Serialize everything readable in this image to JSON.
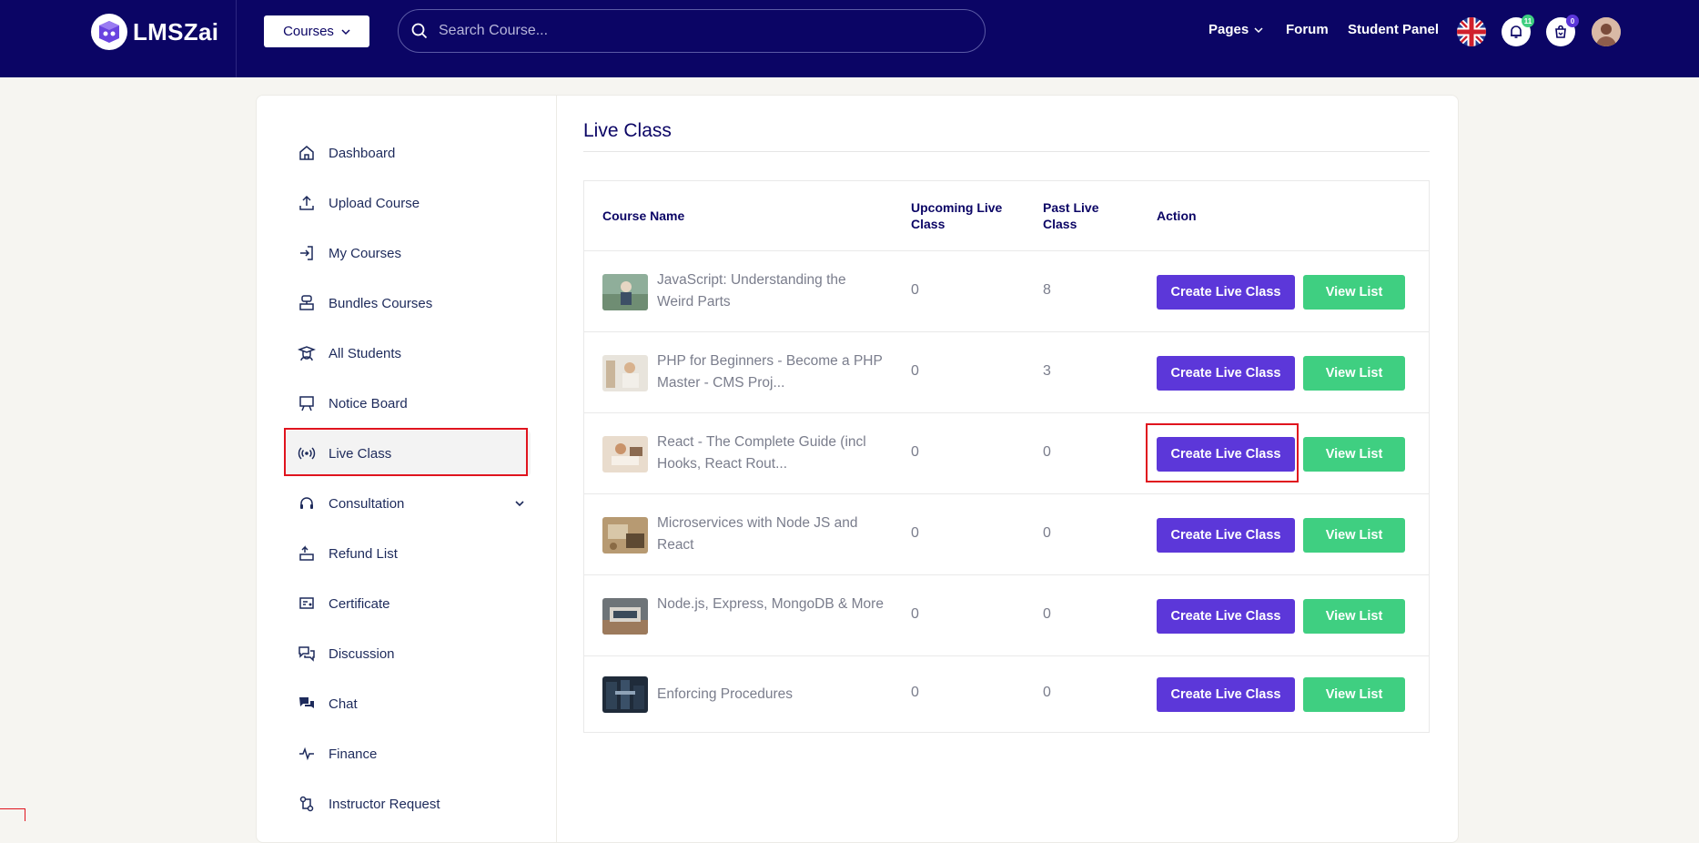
{
  "brand": {
    "name": "LMSZai"
  },
  "header": {
    "courses_label": "Courses",
    "search_placeholder": "Search Course...",
    "nav": {
      "pages": "Pages",
      "forum": "Forum",
      "student_panel": "Student Panel"
    },
    "notification_count": "11",
    "cart_count": "0"
  },
  "sidebar": {
    "items": [
      {
        "label": "Dashboard",
        "icon": "home-icon"
      },
      {
        "label": "Upload Course",
        "icon": "upload-icon"
      },
      {
        "label": "My Courses",
        "icon": "login-icon"
      },
      {
        "label": "Bundles Courses",
        "icon": "bundle-icon"
      },
      {
        "label": "All Students",
        "icon": "student-icon"
      },
      {
        "label": "Notice Board",
        "icon": "board-icon"
      },
      {
        "label": "Live Class",
        "icon": "broadcast-icon",
        "active": true
      },
      {
        "label": "Consultation",
        "icon": "headset-icon",
        "expandable": true
      },
      {
        "label": "Refund List",
        "icon": "refund-icon"
      },
      {
        "label": "Certificate",
        "icon": "certificate-icon"
      },
      {
        "label": "Discussion",
        "icon": "discussion-icon"
      },
      {
        "label": "Chat",
        "icon": "chat-icon"
      },
      {
        "label": "Finance",
        "icon": "pulse-icon"
      },
      {
        "label": "Instructor Request",
        "icon": "request-icon"
      }
    ]
  },
  "main": {
    "title": "Live Class",
    "columns": [
      "Course Name",
      "Upcoming Live Class",
      "Past Live Class",
      "Action"
    ],
    "create_label": "Create Live Class",
    "view_label": "View List",
    "rows": [
      {
        "name": "JavaScript: Understanding the Weird Parts",
        "upcoming": "0",
        "past": "8"
      },
      {
        "name": "PHP for Beginners - Become a PHP Master - CMS Proj...",
        "upcoming": "0",
        "past": "3"
      },
      {
        "name": "React - The Complete Guide (incl Hooks, React Rout...",
        "upcoming": "0",
        "past": "0"
      },
      {
        "name": "Microservices with Node JS and React",
        "upcoming": "0",
        "past": "0"
      },
      {
        "name": "Node.js, Express, MongoDB & More",
        "upcoming": "0",
        "past": "0"
      },
      {
        "name": "Enforcing Procedures",
        "upcoming": "0",
        "past": "0"
      }
    ]
  },
  "colors": {
    "header_bg": "#0b0565",
    "create_btn": "#5c37d9",
    "view_btn": "#3fcf81",
    "highlight": "#e0141e"
  }
}
